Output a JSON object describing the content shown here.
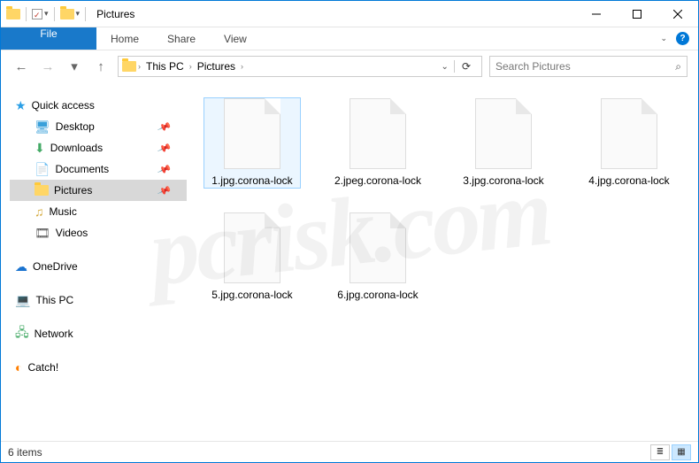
{
  "window": {
    "title": "Pictures"
  },
  "ribbon": {
    "file": "File",
    "tabs": [
      "Home",
      "Share",
      "View"
    ]
  },
  "breadcrumb": [
    "This PC",
    "Pictures"
  ],
  "search": {
    "placeholder": "Search Pictures"
  },
  "sidebar": {
    "quick_access": {
      "label": "Quick access"
    },
    "qa_items": [
      {
        "label": "Desktop",
        "pinned": true
      },
      {
        "label": "Downloads",
        "pinned": true
      },
      {
        "label": "Documents",
        "pinned": true
      },
      {
        "label": "Pictures",
        "pinned": true,
        "selected": true
      },
      {
        "label": "Music",
        "pinned": false
      },
      {
        "label": "Videos",
        "pinned": false
      }
    ],
    "roots": [
      {
        "label": "OneDrive"
      },
      {
        "label": "This PC"
      },
      {
        "label": "Network"
      },
      {
        "label": "Catch!"
      }
    ]
  },
  "files": [
    {
      "name": "1.jpg.corona-lock",
      "selected": true
    },
    {
      "name": "2.jpeg.corona-lock",
      "selected": false
    },
    {
      "name": "3.jpg.corona-lock",
      "selected": false
    },
    {
      "name": "4.jpg.corona-lock",
      "selected": false
    },
    {
      "name": "5.jpg.corona-lock",
      "selected": false
    },
    {
      "name": "6.jpg.corona-lock",
      "selected": false
    }
  ],
  "status": {
    "text": "6 items"
  },
  "watermark": "pcrisk.com"
}
